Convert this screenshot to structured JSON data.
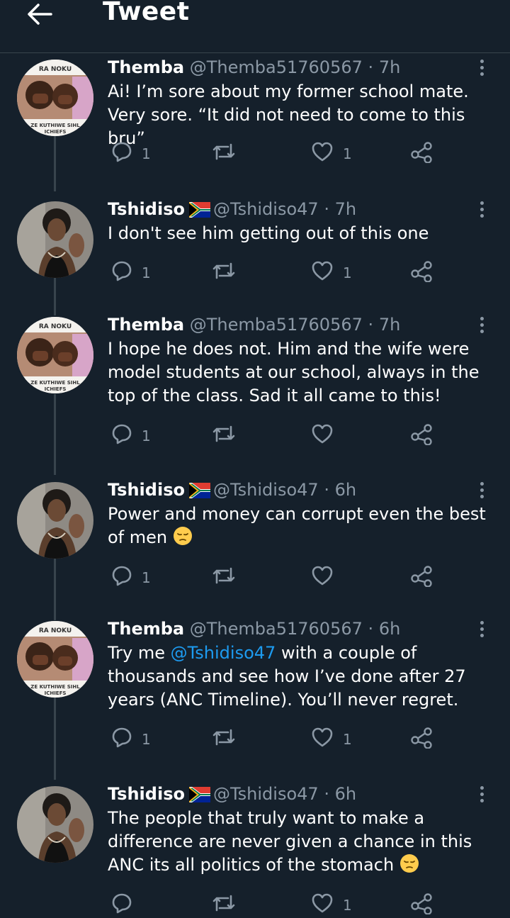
{
  "header": {
    "title": "Tweet"
  },
  "tweets": [
    {
      "name": "Themba",
      "handle": "@Themba51760567",
      "dot": "·",
      "time": "7h",
      "has_flag": false,
      "avatar": "themba",
      "text_before": "Ai! I’m sore about my former school mate. Very sore. “It did not need to come to this bru”",
      "mention": "",
      "text_after": "",
      "emoji": "",
      "reply_count": "1",
      "retweet_count": "",
      "like_count": "1"
    },
    {
      "name": "Tshidiso",
      "handle": "@Tshidiso47",
      "dot": "·",
      "time": "7h",
      "has_flag": true,
      "avatar": "tshidiso",
      "text_before": "I don't see him getting out of this one",
      "mention": "",
      "text_after": "",
      "emoji": "",
      "reply_count": "1",
      "retweet_count": "",
      "like_count": "1"
    },
    {
      "name": "Themba",
      "handle": "@Themba51760567",
      "dot": "·",
      "time": "7h",
      "has_flag": false,
      "avatar": "themba",
      "text_before": "I hope he does not. Him and the wife were model students at our school, always in the top of the class. Sad it all came to this!",
      "mention": "",
      "text_after": "",
      "emoji": "",
      "reply_count": "1",
      "retweet_count": "",
      "like_count": ""
    },
    {
      "name": "Tshidiso",
      "handle": "@Tshidiso47",
      "dot": "·",
      "time": "6h",
      "has_flag": true,
      "avatar": "tshidiso",
      "text_before": "Power and money can corrupt even the best of men",
      "mention": "",
      "text_after": "",
      "emoji": "pensive-face",
      "reply_count": "1",
      "retweet_count": "",
      "like_count": ""
    },
    {
      "name": "Themba",
      "handle": "@Themba51760567",
      "dot": "·",
      "time": "6h",
      "has_flag": false,
      "avatar": "themba",
      "text_before": "Try me ",
      "mention": "@Tshidiso47",
      "text_after": " with a couple of thousands and see how I’ve done after 27 years (ANC Timeline). You’ll never regret.",
      "emoji": "",
      "reply_count": "1",
      "retweet_count": "",
      "like_count": "1"
    },
    {
      "name": "Tshidiso",
      "handle": "@Tshidiso47",
      "dot": "·",
      "time": "6h",
      "has_flag": true,
      "avatar": "tshidiso",
      "text_before": "The people that truly want to make a difference are never given a chance in this ANC its all politics of the stomach",
      "mention": "",
      "text_after": "",
      "emoji": "pensive-face",
      "reply_count": "",
      "retweet_count": "",
      "like_count": "1"
    }
  ],
  "avatar_text": {
    "top": "RA NOKU",
    "bottom1": "ZE KUTHIWE SIHL",
    "bottom2": "ICHIEFS"
  },
  "colors": {
    "background": "#15202b",
    "text": "#ffffff",
    "secondary": "#8b98a5",
    "link": "#1d9bf0",
    "divider": "#38444d"
  },
  "icons": [
    "back-arrow-icon",
    "more-icon",
    "reply-icon",
    "retweet-icon",
    "like-icon",
    "share-icon",
    "south-africa-flag-icon",
    "pensive-face-emoji"
  ]
}
